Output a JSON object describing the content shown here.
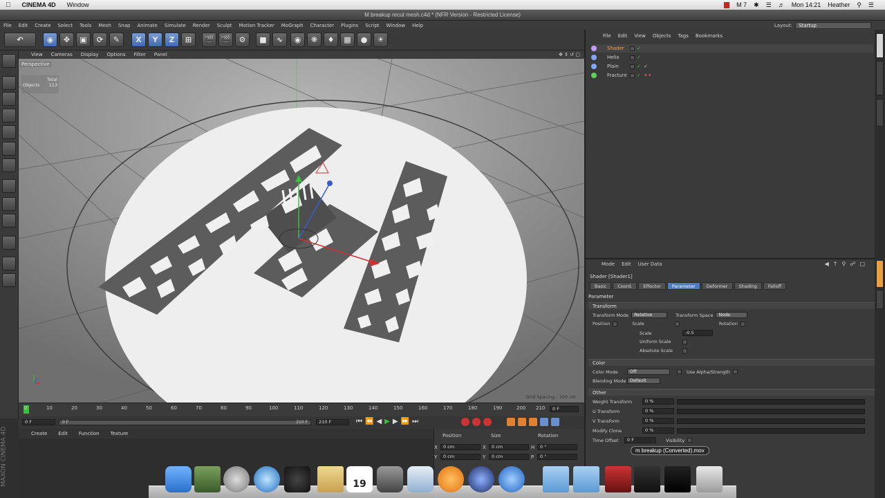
{
  "mac_menubar": {
    "app_name": "CINEMA 4D",
    "menu_window": "Window",
    "clock": "Mon 14:21",
    "user": "Heather",
    "status_m7": "M 7"
  },
  "window_title": "M breakup recut mesh.c4d * (NFR Version - Restricted License)",
  "app_menu": {
    "items": [
      "File",
      "Edit",
      "Create",
      "Select",
      "Tools",
      "Mesh",
      "Snap",
      "Animate",
      "Simulate",
      "Render",
      "Sculpt",
      "Motion Tracker",
      "MoGraph",
      "Character",
      "Plugins",
      "Script",
      "Window",
      "Help"
    ],
    "layout_label": "Layout:",
    "layout_value": "Startup"
  },
  "toolbar": {
    "axis_x": "X",
    "axis_y": "Y",
    "axis_z": "Z"
  },
  "viewport": {
    "menu": [
      "View",
      "Cameras",
      "Display",
      "Options",
      "Filter",
      "Panel"
    ],
    "camera_label": "Perspective",
    "stats_header": "Total",
    "stats_label": "Objects",
    "stats_value": "113",
    "grid_spacing": "Grid Spacing : 100 cm"
  },
  "timeline": {
    "ticks": [
      "0",
      "10",
      "20",
      "30",
      "40",
      "50",
      "60",
      "70",
      "80",
      "90",
      "100",
      "110",
      "120",
      "130",
      "140",
      "150",
      "160",
      "170",
      "180",
      "190",
      "200",
      "210"
    ],
    "current_frame_right": "0 F",
    "start_field": "0 F",
    "range_start": "0 F",
    "range_end": "210 F",
    "end_field": "210 F"
  },
  "material_menu": [
    "Create",
    "Edit",
    "Function",
    "Texture"
  ],
  "coordinates": {
    "headers": [
      "Position",
      "Size",
      "Rotation"
    ],
    "rows": [
      {
        "axis": "X",
        "pos": "0 cm",
        "size": "0 cm",
        "rot_label": "H",
        "rot": "0 °"
      },
      {
        "axis": "Y",
        "pos": "0 cm",
        "size": "0 cm",
        "rot_label": "P",
        "rot": "0 °"
      }
    ]
  },
  "object_manager": {
    "menu": [
      "File",
      "Edit",
      "View",
      "Objects",
      "Tags",
      "Bookmarks"
    ],
    "objects": [
      {
        "name": "Shader",
        "color": "#c0a0ff"
      },
      {
        "name": "Helix",
        "color": "#7fa7ff"
      },
      {
        "name": "Plain",
        "color": "#7fa7ff"
      },
      {
        "name": "Fracture",
        "color": "#5bd15b"
      }
    ]
  },
  "attribute_manager": {
    "menu": [
      "Mode",
      "Edit",
      "User Data"
    ],
    "object_name": "Shader [Shader1]",
    "tabs": [
      "Basic",
      "Coord.",
      "Effector",
      "Parameter",
      "Deformer",
      "Shading",
      "Falloff"
    ],
    "active_tab": "Parameter",
    "param_header": "Parameter",
    "transform": {
      "title": "Transform",
      "mode_label": "Transform Mode",
      "mode_value": "Relative",
      "space_label": "Transform Space",
      "space_value": "Node",
      "position_label": "Position",
      "scale_label": "Scale",
      "rotation_label": "Rotation",
      "scale_value_label": "Scale",
      "scale_value": "-0.5",
      "uniform_scale": "Uniform Scale",
      "absolute_scale": "Absolute Scale"
    },
    "color": {
      "title": "Color",
      "color_mode_label": "Color Mode",
      "color_mode_value": "Off",
      "use_alpha": "Use Alpha/Strength",
      "blending_label": "Blending Mode",
      "blending_value": "Default"
    },
    "other": {
      "title": "Other",
      "rows": [
        {
          "label": "Weight Transform",
          "value": "0 %"
        },
        {
          "label": "U Transform",
          "value": "0 %"
        },
        {
          "label": "V Transform",
          "value": "0 %"
        },
        {
          "label": "Modify Clone",
          "value": "0 %"
        }
      ],
      "time_offset_label": "Time Offset",
      "time_offset_value": "0 F",
      "visibility_label": "Visibility"
    }
  },
  "dock": {
    "tooltip": "m breakup (Converted).mov",
    "calendar_day": "19"
  },
  "side_logo": "MAXON CINEMA 4D"
}
